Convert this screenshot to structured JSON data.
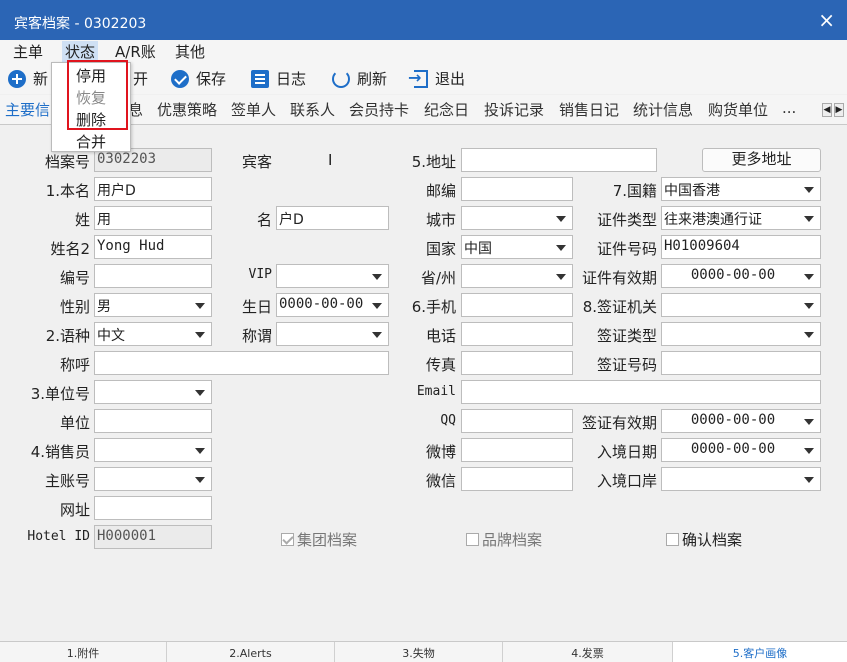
{
  "window": {
    "title": "宾客档案 - 0302203",
    "close": "×"
  },
  "menu": [
    "主单",
    "状态",
    "A/R账",
    "其他"
  ],
  "toolbar": {
    "new": "新",
    "open": "开",
    "save": "保存",
    "log": "日志",
    "refresh": "刷新",
    "exit": "退出"
  },
  "status_menu": {
    "items": [
      "停用",
      "恢复",
      "删除",
      "合并"
    ]
  },
  "tabs": [
    "主要信",
    "息",
    "优惠策略",
    "签单人",
    "联系人",
    "会员持卡",
    "纪念日",
    "投诉记录",
    "销售日记",
    "统计信息",
    "购货单位",
    "..."
  ],
  "tab_nav": {
    "left": "◀",
    "right": "▶"
  },
  "form": {
    "file_no_label": "档案号",
    "file_no": "0302203",
    "guest_label": "宾客",
    "guest_value": "I",
    "name_label": "1.本名",
    "name": "用户D",
    "surname_label": "姓",
    "surname": "用",
    "given_label": "名",
    "given": "户D",
    "name2_label": "姓名2",
    "name2": "Yong Hud",
    "code_label": "编号",
    "code": "",
    "vip_label": "VIP",
    "vip": "",
    "gender_label": "性别",
    "gender": "男",
    "birthday_label": "生日",
    "birthday": "0000-00-00",
    "language_label": "2.语种",
    "language": "中文",
    "salutation_label": "称谓",
    "salutation": "",
    "address_title_label": "称呼",
    "address_title": "",
    "unit_no_label": "3.单位号",
    "unit_no": "",
    "unit_label": "单位",
    "unit": "",
    "sales_label": "4.销售员",
    "sales": "",
    "master_label": "主账号",
    "master": "",
    "website_label": "网址",
    "website": "",
    "hotel_id_label": "Hotel ID",
    "hotel_id": "H000001",
    "address_label": "5.地址",
    "address": "",
    "more_address": "更多地址",
    "zip_label": "邮编",
    "zip": "",
    "nationality_label": "7.国籍",
    "nationality": "中国香港",
    "city_label": "城市",
    "city": "",
    "id_type_label": "证件类型",
    "id_type": "往来港澳通行证",
    "country_label": "国家",
    "country": "中国",
    "id_no_label": "证件号码",
    "id_no": "H01009604",
    "province_label": "省/州",
    "province": "",
    "id_expiry_label": "证件有效期",
    "id_expiry": "0000-00-00",
    "mobile_label": "6.手机",
    "mobile": "",
    "visa_office_label": "8.签证机关",
    "visa_office": "",
    "phone_label": "电话",
    "phone": "",
    "visa_type_label": "签证类型",
    "visa_type": "",
    "fax_label": "传真",
    "fax": "",
    "visa_no_label": "签证号码",
    "visa_no": "",
    "email_label": "Email",
    "email": "",
    "qq_label": "QQ",
    "qq": "",
    "visa_expiry_label": "签证有效期",
    "visa_expiry": "0000-00-00",
    "weibo_label": "微博",
    "weibo": "",
    "entry_date_label": "入境日期",
    "entry_date": "0000-00-00",
    "wechat_label": "微信",
    "wechat": "",
    "entry_port_label": "入境口岸",
    "entry_port": "",
    "group_file": "集团档案",
    "group_file_checked": true,
    "brand_file": "品牌档案",
    "brand_file_checked": false,
    "confirm_file": "确认档案",
    "confirm_file_checked": false
  },
  "bottom_tabs": [
    "1.附件",
    "2.Alerts",
    "3.失物",
    "4.发票",
    "5.客户画像"
  ],
  "colors": {
    "titlebar": "#2b65b5",
    "accent": "#1e6ec8",
    "highlight": "#e0141e"
  }
}
